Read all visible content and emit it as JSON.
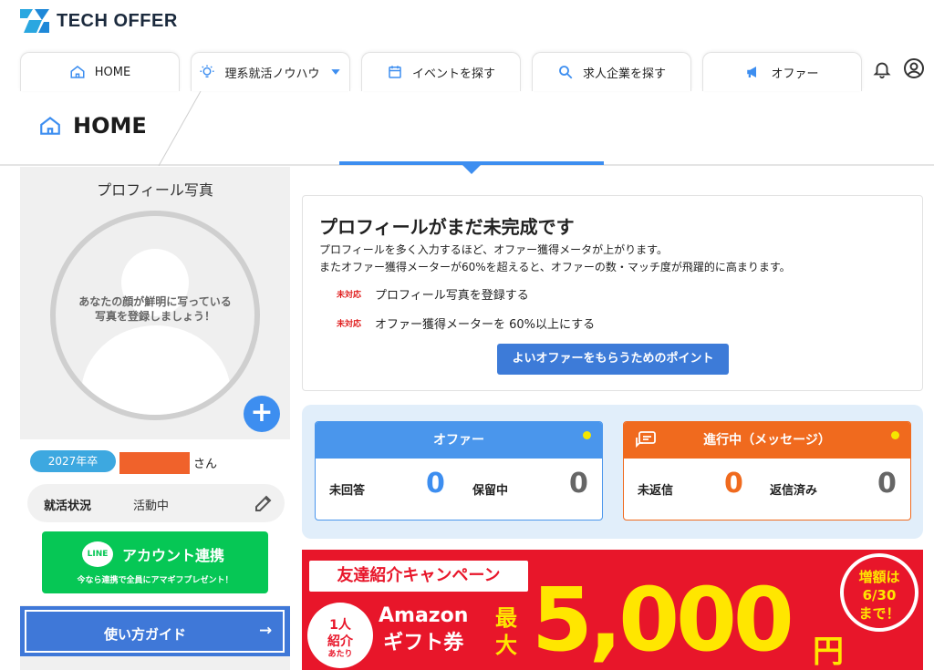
{
  "brand": {
    "name": "TECH OFFER"
  },
  "nav": {
    "tabs": [
      {
        "label": "HOME",
        "icon": "home-icon"
      },
      {
        "label": "理系就活ノウハウ",
        "icon": "lightbulb-icon"
      },
      {
        "label": "イベントを探す",
        "icon": "calendar-icon"
      },
      {
        "label": "求人企業を探す",
        "icon": "search-icon"
      },
      {
        "label": "オファー",
        "icon": "megaphone-icon"
      }
    ]
  },
  "page": {
    "title": "HOME"
  },
  "sidebar": {
    "photo_title": "プロフィール写真",
    "photo_message_line1": "あなたの顔が鮮明に写っている",
    "photo_message_line2": "写真を登録しましょう！",
    "year_badge": "2027年卒",
    "name_suffix": "さん",
    "status_label": "就活状況",
    "status_value": "活動中",
    "line_logo": "LINE",
    "line_button_label": "アカウント連携",
    "line_button_sub": "今なら連携で全員にアマギフプレゼント！",
    "guide_label": "使い方ガイド",
    "guide_arrow": "→"
  },
  "profile_card": {
    "heading": "プロフィールがまだ未完成です",
    "desc_line1": "プロフィールを多く入力するほど、オファー獲得メータが上がります。",
    "desc_line2": "またオファー獲得メーターが60%を超えると、オファーの数・マッチ度が飛躍的に高まります。",
    "todos": [
      {
        "tag": "未対応",
        "text": "プロフィール写真を登録する"
      },
      {
        "tag": "未対応",
        "text": "オファー獲得メーターを 60%以上にする"
      }
    ],
    "button_label": "よいオファーをもらうためのポイント"
  },
  "stats": {
    "offer": {
      "title": "オファー",
      "k1": "未回答",
      "v1": "0",
      "k2": "保留中",
      "v2": "0",
      "color": "#4a96ec",
      "value_color": "#3d8ef0"
    },
    "messages": {
      "title": "進行中（メッセージ）",
      "k1": "未返信",
      "v1": "0",
      "k2": "返信済み",
      "v2": "0",
      "color": "#f06a1e",
      "value_color": "#f06a1e"
    }
  },
  "banner": {
    "campaign": "友達紹介キャンペーン",
    "per_person_line1": "1人",
    "per_person_line2": "紹介",
    "per_person_small": "あたり",
    "gift_line1": "Amazon",
    "gift_line2": "ギフト券",
    "max_line1": "最",
    "max_line2": "大",
    "amount": "5,000",
    "currency": "円",
    "burst_line1": "増額は",
    "burst_line2": "6/30",
    "burst_line3": "まで！"
  },
  "colors": {
    "accent": "#3d8ef0",
    "line_green": "#06c755",
    "banner_red": "#e8162a",
    "banner_yellow": "#ffe600"
  }
}
